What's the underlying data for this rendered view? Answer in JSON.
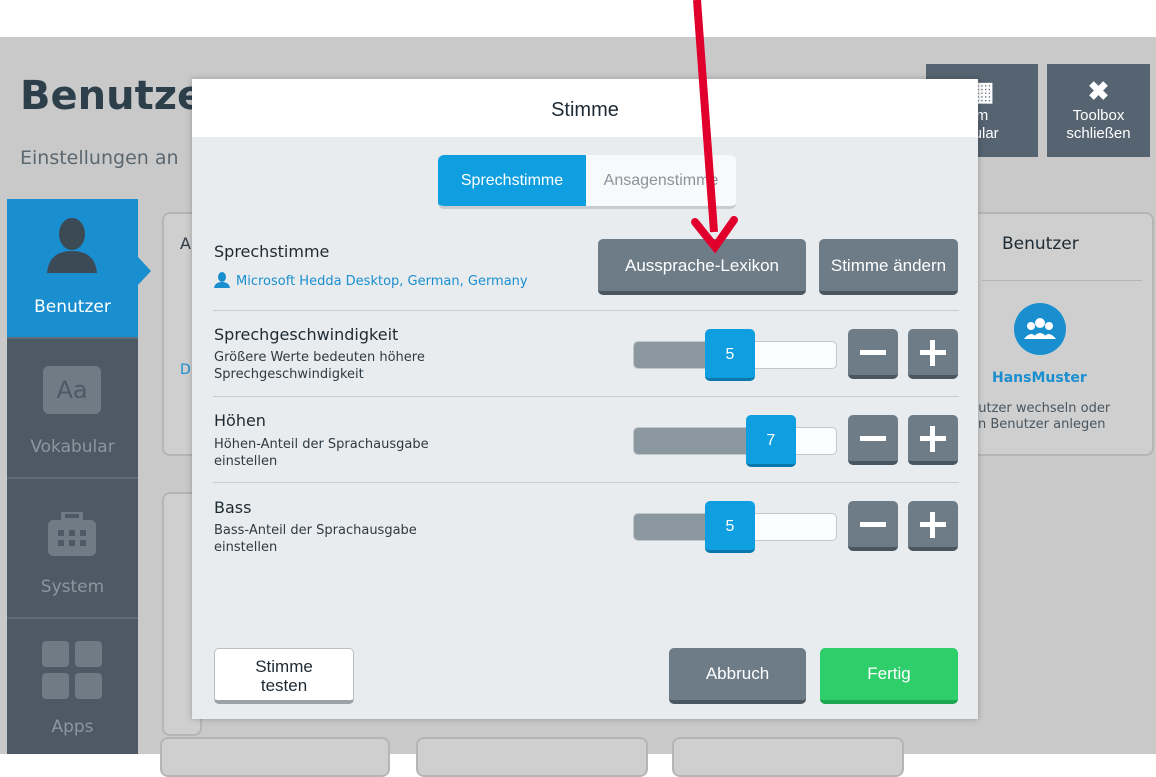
{
  "background": {
    "title": "Benutzer",
    "subtitle": "Einstellungen an",
    "toolbar": [
      {
        "icon": "grid-icon",
        "line1": "m",
        "line2": "bular"
      },
      {
        "icon": "close-icon",
        "line1": "Toolbox",
        "line2": "schließen"
      }
    ],
    "sidebar": [
      {
        "label": "Benutzer",
        "icon": "user-icon",
        "active": true
      },
      {
        "label": "Vokabular",
        "icon": "aa-icon",
        "glyph": "Aa",
        "active": false
      },
      {
        "label": "System",
        "icon": "toolbox-icon",
        "active": false
      },
      {
        "label": "Apps",
        "icon": "apps-icon",
        "active": false
      }
    ],
    "card_letters": [
      "A",
      "D"
    ],
    "user_card": {
      "title": "Benutzer",
      "user_name": "HansMuster",
      "hint_line1": "nutzer wechseln oder",
      "hint_line2": "en Benutzer anlegen"
    }
  },
  "dialog": {
    "title": "Stimme",
    "tabs": [
      {
        "label": "Sprechstimme",
        "active": true
      },
      {
        "label": "Ansagenstimme",
        "active": false
      }
    ],
    "voice": {
      "title": "Sprechstimme",
      "name": "Microsoft Hedda Desktop, German, Germany",
      "lexicon_button": "Aussprache-Lexikon",
      "change_button": "Stimme ändern"
    },
    "sliders": [
      {
        "title": "Sprechgeschwindigkeit",
        "desc_line1": "Größere Werte bedeuten höhere",
        "desc_line2": "Sprechgeschwindigkeit",
        "value": "5",
        "fraction": 0.5
      },
      {
        "title": "Höhen",
        "desc_line1": "Höhen-Anteil der Sprachausgabe",
        "desc_line2": "einstellen",
        "value": "7",
        "fraction": 0.7
      },
      {
        "title": "Bass",
        "desc_line1": "Bass-Anteil der Sprachausgabe",
        "desc_line2": "einstellen",
        "value": "5",
        "fraction": 0.5
      }
    ],
    "footer": {
      "test_line1": "Stimme",
      "test_line2": "testen",
      "cancel": "Abbruch",
      "done": "Fertig"
    }
  },
  "colors": {
    "accent": "#0f9fe0",
    "done_green": "#2ecf6a",
    "annotation_arrow": "#e0002b"
  }
}
